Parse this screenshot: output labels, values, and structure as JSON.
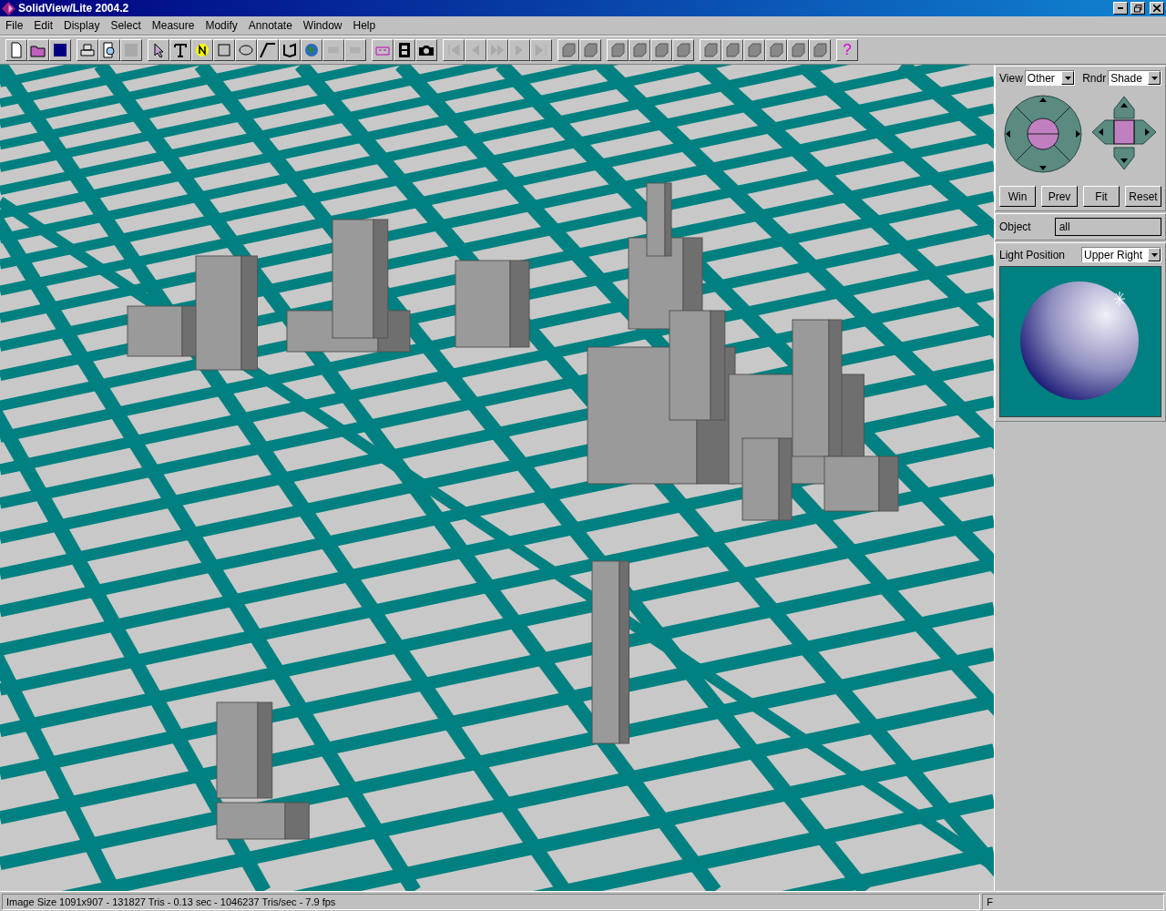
{
  "window": {
    "title": "SolidView/Lite 2004.2"
  },
  "menu": [
    "File",
    "Edit",
    "Display",
    "Select",
    "Measure",
    "Modify",
    "Annotate",
    "Window",
    "Help"
  ],
  "toolbar": [
    {
      "kind": "new",
      "disabled": false
    },
    {
      "kind": "open",
      "disabled": false
    },
    {
      "kind": "save",
      "disabled": false
    },
    {
      "kind": "sep"
    },
    {
      "kind": "print",
      "disabled": false
    },
    {
      "kind": "preview",
      "disabled": false
    },
    {
      "kind": "blank",
      "disabled": true
    },
    {
      "kind": "sep"
    },
    {
      "kind": "pointer",
      "disabled": false
    },
    {
      "kind": "text",
      "disabled": false
    },
    {
      "kind": "note",
      "disabled": false
    },
    {
      "kind": "rect",
      "disabled": false
    },
    {
      "kind": "ellipse",
      "disabled": false
    },
    {
      "kind": "line",
      "disabled": false
    },
    {
      "kind": "polyline",
      "disabled": false
    },
    {
      "kind": "globe",
      "disabled": false
    },
    {
      "kind": "shape",
      "disabled": true
    },
    {
      "kind": "shape",
      "disabled": true
    },
    {
      "kind": "sep"
    },
    {
      "kind": "ruler",
      "disabled": false
    },
    {
      "kind": "film",
      "disabled": false
    },
    {
      "kind": "camera",
      "disabled": false
    },
    {
      "kind": "sep"
    },
    {
      "kind": "first",
      "disabled": true
    },
    {
      "kind": "prev",
      "disabled": true
    },
    {
      "kind": "ffwd",
      "disabled": true
    },
    {
      "kind": "next",
      "disabled": true
    },
    {
      "kind": "last",
      "disabled": true
    },
    {
      "kind": "sep"
    },
    {
      "kind": "view",
      "disabled": false
    },
    {
      "kind": "view",
      "disabled": false
    },
    {
      "kind": "sep"
    },
    {
      "kind": "view",
      "disabled": false
    },
    {
      "kind": "view",
      "disabled": false
    },
    {
      "kind": "view",
      "disabled": false
    },
    {
      "kind": "view",
      "disabled": false
    },
    {
      "kind": "sep"
    },
    {
      "kind": "view",
      "disabled": false
    },
    {
      "kind": "view",
      "disabled": false
    },
    {
      "kind": "view",
      "disabled": false
    },
    {
      "kind": "view",
      "disabled": false
    },
    {
      "kind": "view",
      "disabled": false
    },
    {
      "kind": "view",
      "disabled": false
    },
    {
      "kind": "sep"
    },
    {
      "kind": "help",
      "label": "?",
      "disabled": false
    }
  ],
  "view_panel": {
    "view_label": "View",
    "view_value": "Other",
    "render_label": "Rndr",
    "render_value": "Shade",
    "buttons": [
      "Win",
      "Prev",
      "Fit",
      "Reset"
    ]
  },
  "object": {
    "label": "Object",
    "value": "all"
  },
  "light": {
    "label": "Light Position",
    "value": "Upper Right"
  },
  "status_bar": {
    "text": "Image Size 1091x907 - 131827 Tris -  0.13 sec - 1046237 Tris/sec -  7.9 fps",
    "flag": "F"
  }
}
